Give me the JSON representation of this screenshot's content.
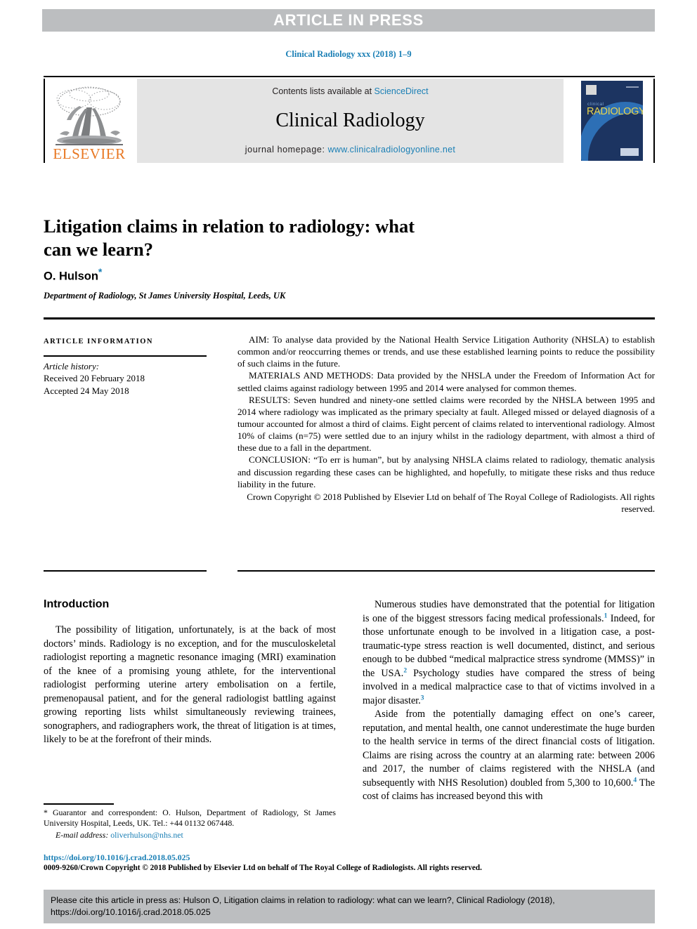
{
  "banner": {
    "label": "ARTICLE IN PRESS"
  },
  "running_head": {
    "text": "Clinical Radiology xxx (2018) 1–9"
  },
  "journal_header": {
    "publisher_name": "ELSEVIER",
    "publisher_logo_icon": "elsevier-tree-icon",
    "contents_prefix": "Contents lists available at ",
    "contents_link": "ScienceDirect",
    "journal_title": "Clinical Radiology",
    "homepage_prefix": "journal homepage: ",
    "homepage_link": "www.clinicalradiologyonline.net",
    "cover": {
      "small_word": "clinical",
      "main_word": "RADIOLOGY"
    }
  },
  "article": {
    "title": "Litigation claims in relation to radiology: what can we learn?",
    "author": "O. Hulson",
    "author_marker": "*",
    "affiliation": "Department of Radiology, St James University Hospital, Leeds, UK"
  },
  "article_information": {
    "heading": "ARTICLE INFORMATION",
    "history_label": "Article history:",
    "received": "Received 20 February 2018",
    "accepted": "Accepted 24 May 2018"
  },
  "abstract": {
    "aim": "AIM: To analyse data provided by the National Health Service Litigation Authority (NHSLA) to establish common and/or reoccurring themes or trends, and use these established learning points to reduce the possibility of such claims in the future.",
    "materials": "MATERIALS AND METHODS: Data provided by the NHSLA under the Freedom of Information Act for settled claims against radiology between 1995 and 2014 were analysed for common themes.",
    "results": "RESULTS: Seven hundred and ninety-one settled claims were recorded by the NHSLA between 1995 and 2014 where radiology was implicated as the primary specialty at fault. Alleged missed or delayed diagnosis of a tumour accounted for almost a third of claims. Eight percent of claims related to interventional radiology. Almost 10% of claims (n=75) were settled due to an injury whilst in the radiology department, with almost a third of these due to a fall in the department.",
    "conclusion": "CONCLUSION: “To err is human”, but by analysing NHSLA claims related to radiology, thematic analysis and discussion regarding these cases can be highlighted, and hopefully, to mitigate these risks and thus reduce liability in the future.",
    "copyright": "Crown Copyright © 2018 Published by Elsevier Ltd on behalf of The Royal College of Radiologists. All rights reserved."
  },
  "body": {
    "introduction_heading": "Introduction",
    "left_paragraph_1": "The possibility of litigation, unfortunately, is at the back of most doctors’ minds. Radiology is no exception, and for the musculoskeletal radiologist reporting a magnetic resonance imaging (MRI) examination of the knee of a promising young athlete, for the interventional radiologist performing uterine artery embolisation on a fertile, premenopausal patient, and for the general radiologist battling against growing reporting lists whilst simultaneously reviewing trainees, sonographers, and radiographers work, the threat of litigation is at times, likely to be at the forefront of their minds.",
    "right_paragraph_1_a": "Numerous studies have demonstrated that the potential for litigation is one of the biggest stressors facing medical professionals.",
    "right_paragraph_1_cite1": "1",
    "right_paragraph_1_b": " Indeed, for those unfortunate enough to be involved in a litigation case, a post-traumatic-type stress reaction is well documented, distinct, and serious enough to be dubbed “medical malpractice stress syndrome (MMSS)” in the USA.",
    "right_paragraph_1_cite2": "2",
    "right_paragraph_1_c": " Psychology studies have compared the stress of being involved in a medical malpractice case to that of victims involved in a major disaster.",
    "right_paragraph_1_cite3": "3",
    "right_paragraph_2_a": "Aside from the potentially damaging effect on one’s career, reputation, and mental health, one cannot underestimate the huge burden to the health service in terms of the direct financial costs of litigation. Claims are rising across the country at an alarming rate: between 2006 and 2017, the number of claims registered with the NHSLA (and subsequently with NHS Resolution) doubled from 5,300 to 10,600.",
    "right_paragraph_2_cite4": "4",
    "right_paragraph_2_b": " The cost of claims has increased beyond this with"
  },
  "footnote": {
    "correspondence": "* Guarantor and correspondent: O. Hulson, Department of Radiology, St James University Hospital, Leeds, UK. Tel.: +44 01132 067448.",
    "email_label": "E-mail address: ",
    "email": "oliverhulson@nhs.net"
  },
  "footer": {
    "doi": "https://doi.org/10.1016/j.crad.2018.05.025",
    "issn_copyright": "0009-9260/Crown Copyright © 2018 Published by Elsevier Ltd on behalf of The Royal College of Radiologists. All rights reserved."
  },
  "cite_box": {
    "text": "Please cite this article in press as: Hulson O, Litigation claims in relation to radiology: what can we learn?, Clinical Radiology (2018), https://doi.org/10.1016/j.crad.2018.05.025"
  },
  "colors": {
    "link_blue": "#1a7fb5",
    "banner_grey": "#bcbec0",
    "elsevier_orange": "#e87722",
    "cover_navy": "#1c3461"
  }
}
